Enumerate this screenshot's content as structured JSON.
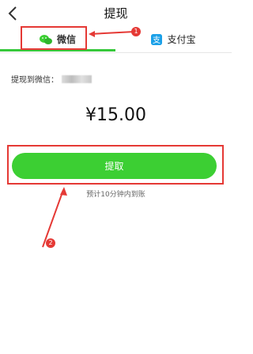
{
  "header": {
    "title": "提现"
  },
  "tabs": [
    {
      "label": "微信",
      "icon": "wechat-icon"
    },
    {
      "label": "支付宝",
      "icon": "alipay-icon"
    }
  ],
  "withdraw": {
    "to_label": "提现到微信："
  },
  "amount": "¥15.00",
  "button_label": "提取",
  "note": "预计10分钟内到账",
  "annotations": {
    "badge1": "1",
    "badge2": "2"
  },
  "colors": {
    "accent_green": "#3ccf33",
    "annotation_red": "#e53935"
  }
}
